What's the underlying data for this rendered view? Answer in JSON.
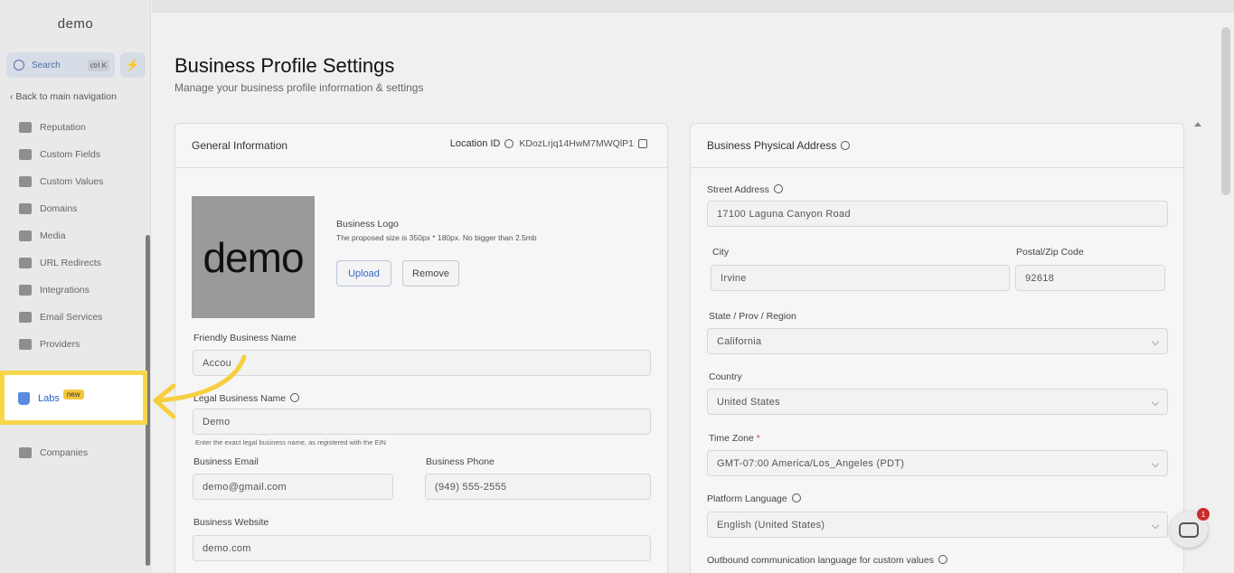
{
  "brand": "demo",
  "sidebar": {
    "search_label": "Search",
    "search_shortcut": "ctrl K",
    "back_label": "Back to main navigation",
    "items": [
      {
        "label": "Reputation",
        "icon": "star-icon"
      },
      {
        "label": "Custom Fields",
        "icon": "fields-icon"
      },
      {
        "label": "Custom Values",
        "icon": "values-icon"
      },
      {
        "label": "Domains",
        "icon": "globe-icon"
      },
      {
        "label": "Media",
        "icon": "media-icon"
      },
      {
        "label": "URL Redirects",
        "icon": "redirect-icon"
      },
      {
        "label": "Integrations",
        "icon": "integrations-icon"
      },
      {
        "label": "Email Services",
        "icon": "email-icon"
      },
      {
        "label": "Providers",
        "icon": "providers-icon"
      },
      {
        "label": "Companies",
        "icon": "companies-icon"
      }
    ],
    "labs": {
      "label": "Labs",
      "badge": "new"
    }
  },
  "page": {
    "title": "Business Profile Settings",
    "subtitle": "Manage your business profile information & settings"
  },
  "general": {
    "title": "General Information",
    "location_label": "Location ID",
    "location_id": "KDozLrjq14HwM7MWQlP1",
    "logo_text": "demo",
    "logo_label": "Business Logo",
    "logo_hint": "The proposed size is 350px * 180px. No bigger than 2.5mb",
    "upload": "Upload",
    "remove": "Remove",
    "friendly_label": "Friendly Business Name",
    "friendly_value": "Accou",
    "legal_label": "Legal Business Name",
    "legal_value": "Demo",
    "legal_hint": "Enter the exact legal business name, as registered with the EIN",
    "email_label": "Business Email",
    "email_value": "demo@gmail.com",
    "phone_label": "Business Phone",
    "phone_value": "(949) 555-2555",
    "website_label": "Business Website",
    "website_value": "demo.com"
  },
  "address": {
    "title": "Business Physical Address",
    "street_label": "Street Address",
    "street_value": "17100 Laguna Canyon Road",
    "city_label": "City",
    "city_value": "Irvine",
    "zip_label": "Postal/Zip Code",
    "zip_value": "92618",
    "state_label": "State / Prov / Region",
    "state_value": "California",
    "country_label": "Country",
    "country_value": "United States",
    "tz_label": "Time Zone",
    "tz_required": "*",
    "tz_value": "GMT-07:00 America/Los_Angeles (PDT)",
    "lang_label": "Platform Language",
    "lang_value": "English (United States)",
    "outbound_label": "Outbound communication language for custom values"
  },
  "chat_count": "1"
}
